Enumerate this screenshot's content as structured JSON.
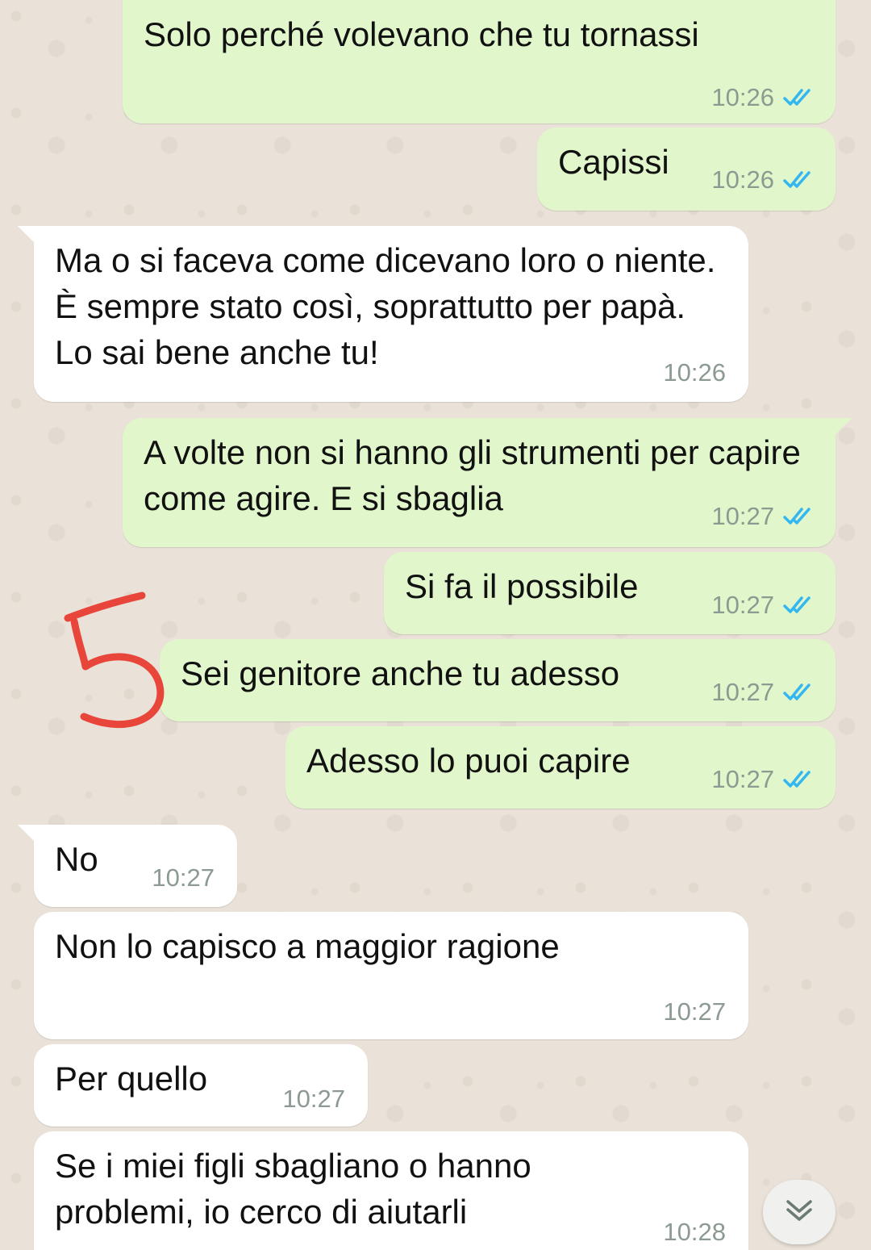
{
  "messages": [
    {
      "text": "Solo perché volevano che tu tornassi",
      "time": "10:26",
      "direction": "outgoing",
      "status": "read"
    },
    {
      "text": "Capissi",
      "time": "10:26",
      "direction": "outgoing",
      "status": "read"
    },
    {
      "text": "Ma o si faceva come dicevano loro o niente. È sempre stato così, soprattutto per papà. Lo sai bene anche tu!",
      "time": "10:26",
      "direction": "incoming"
    },
    {
      "text": "A volte non si hanno gli strumenti per capire come agire. E si sbaglia",
      "time": "10:27",
      "direction": "outgoing",
      "status": "read"
    },
    {
      "text": "Si fa il possibile",
      "time": "10:27",
      "direction": "outgoing",
      "status": "read"
    },
    {
      "text": "Sei genitore anche tu adesso",
      "time": "10:27",
      "direction": "outgoing",
      "status": "read"
    },
    {
      "text": "Adesso lo puoi capire",
      "time": "10:27",
      "direction": "outgoing",
      "status": "read"
    },
    {
      "text": "No",
      "time": "10:27",
      "direction": "incoming"
    },
    {
      "text": "Non lo capisco a maggior ragione",
      "time": "10:27",
      "direction": "incoming"
    },
    {
      "text": "Per quello",
      "time": "10:27",
      "direction": "incoming"
    },
    {
      "text": "Se i miei figli sbagliano o hanno problemi, io cerco di aiutarli",
      "time": "10:28",
      "direction": "incoming"
    }
  ],
  "annotation": {
    "text": "5",
    "color": "#E8463A"
  },
  "colors": {
    "outgoing_bubble": "#E1F7CB",
    "incoming_bubble": "#FFFFFF",
    "read_ticks": "#34B7F1",
    "timestamp": "#8C9A92",
    "wallpaper": "#EAE2D8"
  },
  "icons": {
    "read_receipt": "double-check-icon",
    "scroll_down": "double-chevron-down-icon"
  }
}
